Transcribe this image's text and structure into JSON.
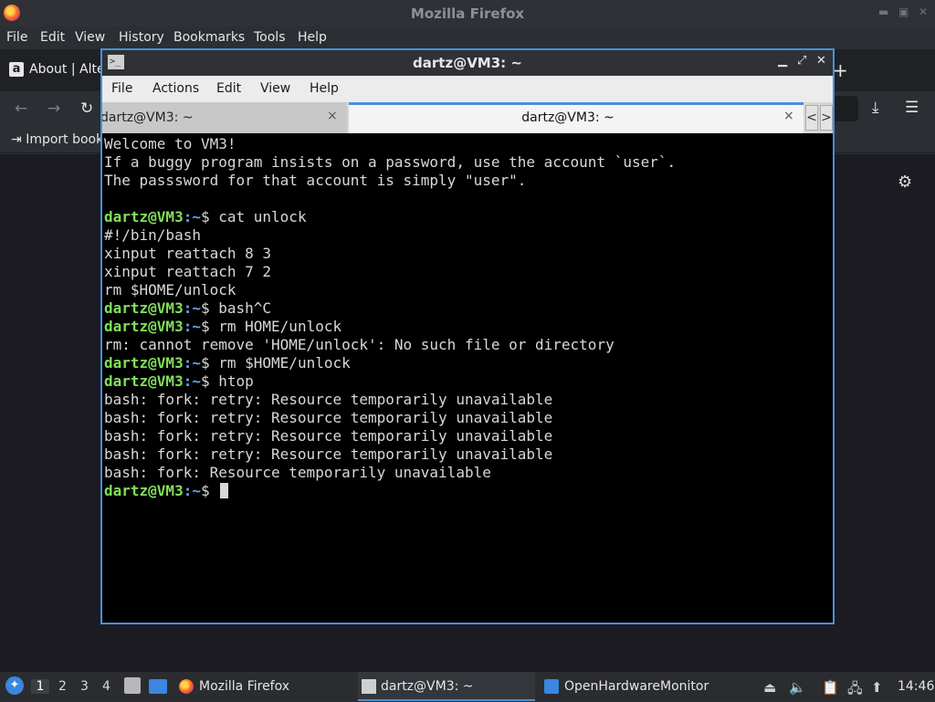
{
  "firefox": {
    "window_title": "Mozilla Firefox",
    "menu": [
      "File",
      "Edit",
      "View",
      "History",
      "Bookmarks",
      "Tools",
      "Help"
    ],
    "tab_title": "About | Alte",
    "tab_icon": "a",
    "new_tab": "+",
    "bookmark_import": "Import book",
    "icons": {
      "back": "back-arrow-icon",
      "forward": "forward-arrow-icon",
      "reload": "reload-icon",
      "download": "download-icon",
      "menu": "hamburger-menu-icon",
      "settings": "gear-icon"
    }
  },
  "terminal": {
    "window_title": "dartz@VM3: ~",
    "menu": [
      "File",
      "Actions",
      "Edit",
      "View",
      "Help"
    ],
    "tabs": [
      {
        "label": "dartz@VM3: ~",
        "active": false
      },
      {
        "label": "dartz@VM3: ~",
        "active": true
      }
    ],
    "tab_close": "×",
    "tab_scroll_left": "<",
    "tab_scroll_right": ">",
    "prompt": {
      "user": "dartz@VM3",
      "path": ":~",
      "symbol": "$"
    },
    "lines": [
      {
        "type": "out",
        "text": "Welcome to VM3!"
      },
      {
        "type": "out",
        "text": "If a buggy program insists on a password, use the account `user`."
      },
      {
        "type": "out",
        "text": "The passsword for that account is simply \"user\"."
      },
      {
        "type": "out",
        "text": ""
      },
      {
        "type": "cmd",
        "text": " cat unlock"
      },
      {
        "type": "out",
        "text": "#!/bin/bash"
      },
      {
        "type": "out",
        "text": "xinput reattach 8 3"
      },
      {
        "type": "out",
        "text": "xinput reattach 7 2"
      },
      {
        "type": "out",
        "text": "rm $HOME/unlock"
      },
      {
        "type": "cmd",
        "text": " bash^C"
      },
      {
        "type": "cmd",
        "text": " rm HOME/unlock"
      },
      {
        "type": "out",
        "text": "rm: cannot remove 'HOME/unlock': No such file or directory"
      },
      {
        "type": "cmd",
        "text": " rm $HOME/unlock"
      },
      {
        "type": "cmd",
        "text": " htop"
      },
      {
        "type": "out",
        "text": "bash: fork: retry: Resource temporarily unavailable"
      },
      {
        "type": "out",
        "text": "bash: fork: retry: Resource temporarily unavailable"
      },
      {
        "type": "out",
        "text": "bash: fork: retry: Resource temporarily unavailable"
      },
      {
        "type": "out",
        "text": "bash: fork: retry: Resource temporarily unavailable"
      },
      {
        "type": "out",
        "text": "bash: fork: Resource temporarily unavailable"
      },
      {
        "type": "cmd",
        "text": " ",
        "cursor": true
      }
    ]
  },
  "taskbar": {
    "workspaces": [
      "1",
      "2",
      "3",
      "4"
    ],
    "active_workspace": "1",
    "tasks": [
      {
        "label": "Mozilla Firefox",
        "icon": "firefox-icon"
      },
      {
        "label": "dartz@VM3: ~",
        "icon": "terminal-icon",
        "active": true
      },
      {
        "label": "OpenHardwareMonitor",
        "icon": "window-icon"
      }
    ],
    "tray_icons": [
      "usb-icon",
      "volume-icon",
      "clipboard-icon",
      "network-icon",
      "update-icon"
    ],
    "clock": "14:46"
  },
  "colors": {
    "accent": "#4a90d9",
    "prompt_user": "#7fe05a",
    "prompt_path": "#6aa3e8",
    "terminal_fg": "#d8d8d8",
    "terminal_bg": "#000000"
  }
}
